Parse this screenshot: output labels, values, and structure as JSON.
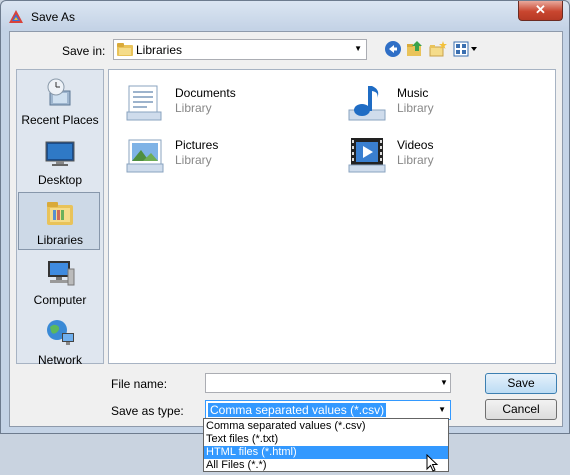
{
  "window": {
    "title": "Save As",
    "close_label": "✕"
  },
  "toolbar": {
    "save_in_label": "Save in:",
    "save_in_value": "Libraries",
    "icons": [
      "back-icon",
      "up-folder-icon",
      "new-folder-icon",
      "views-menu-icon"
    ]
  },
  "places": [
    {
      "label": "Recent Places",
      "icon": "recent-places-icon"
    },
    {
      "label": "Desktop",
      "icon": "desktop-icon"
    },
    {
      "label": "Libraries",
      "icon": "libraries-icon",
      "selected": true
    },
    {
      "label": "Computer",
      "icon": "computer-icon"
    },
    {
      "label": "Network",
      "icon": "network-icon"
    }
  ],
  "libraries": [
    {
      "name": "Documents",
      "type": "Library",
      "icon": "documents-library-icon"
    },
    {
      "name": "Music",
      "type": "Library",
      "icon": "music-library-icon"
    },
    {
      "name": "Pictures",
      "type": "Library",
      "icon": "pictures-library-icon"
    },
    {
      "name": "Videos",
      "type": "Library",
      "icon": "videos-library-icon"
    }
  ],
  "form": {
    "file_name_label": "File name:",
    "file_name_value": "",
    "save_as_type_label": "Save as type:",
    "save_as_type_value": "Comma separated values (*.csv)",
    "save_button": "Save",
    "cancel_button": "Cancel"
  },
  "type_options": [
    {
      "label": "Comma separated values (*.csv)"
    },
    {
      "label": "Text files (*.txt)"
    },
    {
      "label": "HTML files (*.html)",
      "highlighted": true
    },
    {
      "label": "All Files (*.*)"
    }
  ],
  "colors": {
    "selection": "#3399ff",
    "close_button": "#c9462f",
    "frame": "#c4d3e6"
  }
}
